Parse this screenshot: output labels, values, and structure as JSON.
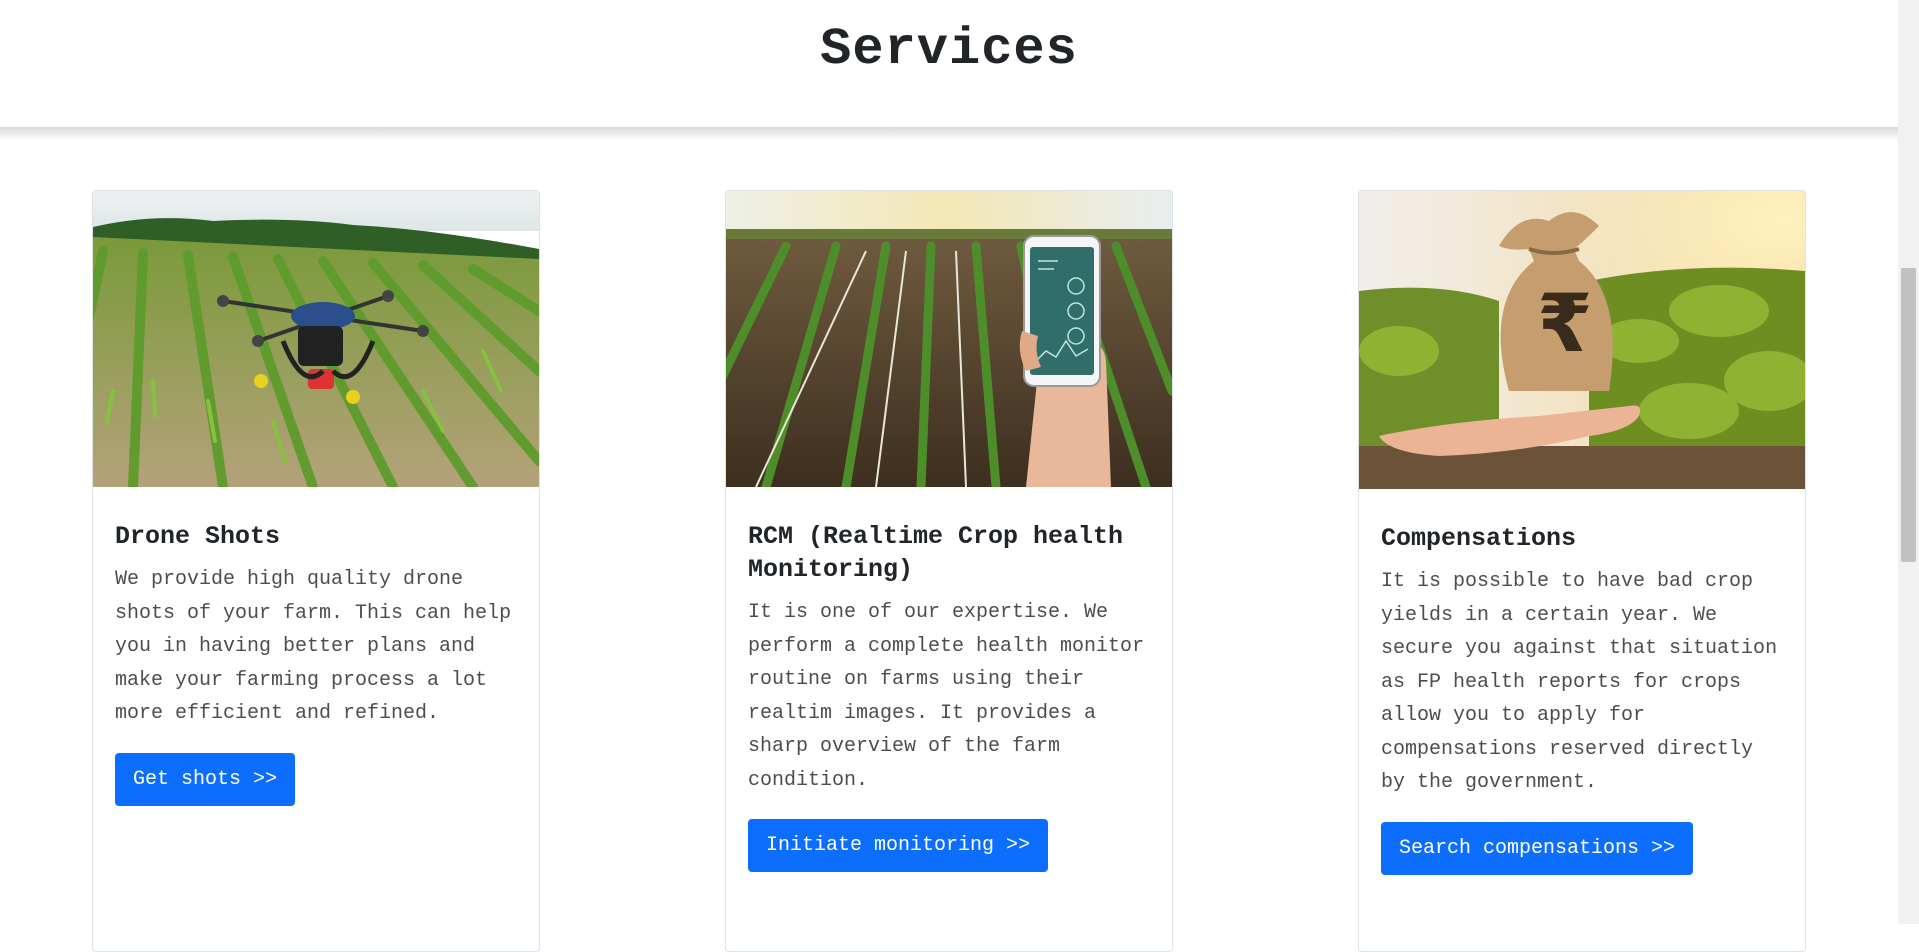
{
  "header": {
    "title": "Services"
  },
  "cards": [
    {
      "title": "Drone Shots",
      "text": "We provide high quality drone shots of your farm. This can help you in having better plans and make your farming process a lot more efficient and refined.",
      "button": "Get shots >>",
      "image_icon": "drone-over-crop-field-image"
    },
    {
      "title": "RCM (Realtime Crop health Monitoring)",
      "text": "It is one of our expertise. We perform a complete health monitor routine on farms using their realtim images. It provides a sharp overview of the farm condition.",
      "button": "Initiate monitoring >>",
      "image_icon": "phone-over-crop-rows-image"
    },
    {
      "title": "Compensations",
      "text": "It is possible to have bad crop yields in a certain year. We secure you against that situation as FP health reports for crops allow you to apply for compensations reserved directly by the government.",
      "button": "Search compensations >>",
      "image_icon": "money-bag-rupee-image",
      "bag_glyph": "₹"
    }
  ],
  "colors": {
    "primary": "#0d6efd",
    "text": "#212529",
    "muted_text": "#4d4d4d",
    "border": "#dee2e6"
  }
}
